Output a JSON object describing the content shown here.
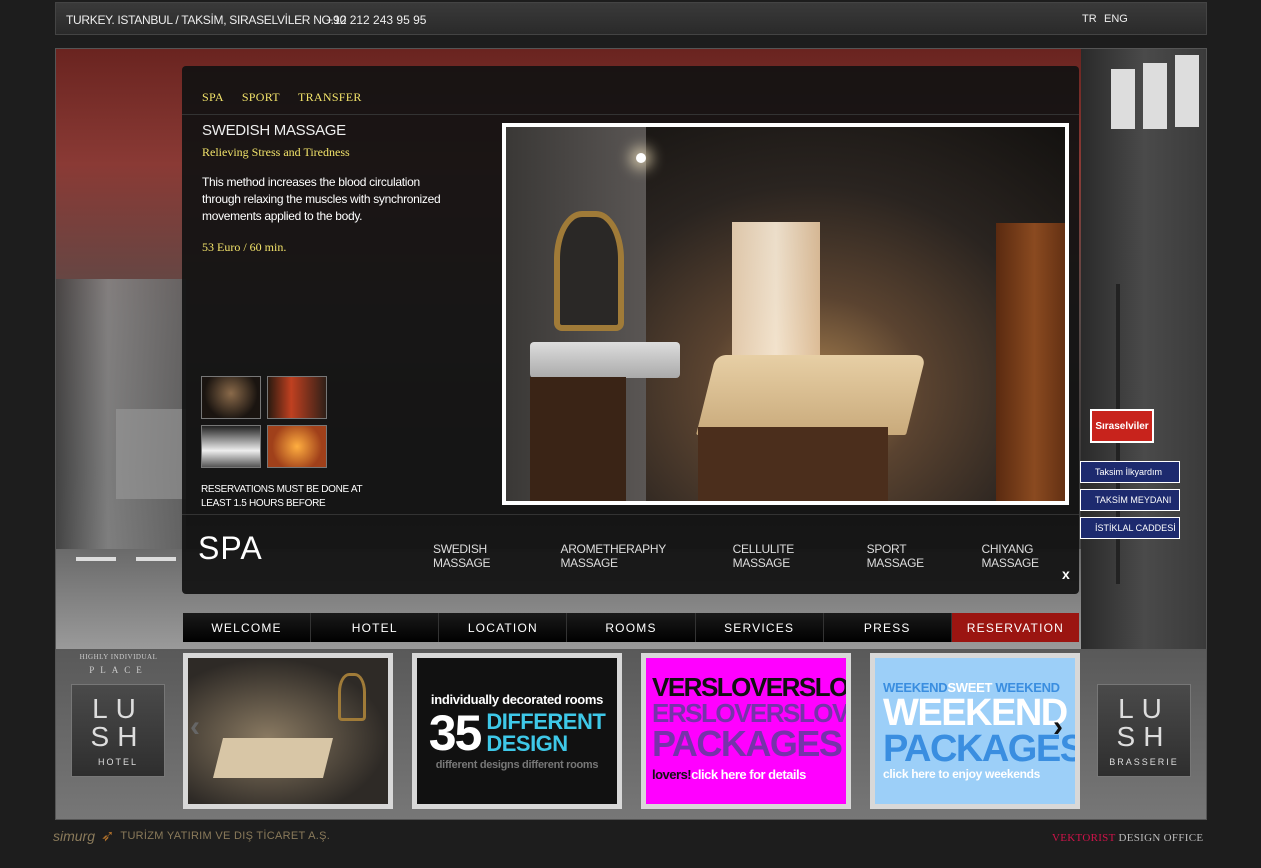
{
  "topbar": {
    "address": "TURKEY. ISTANBUL / TAKSİM, SIRASELVİLER NO.12",
    "phone": "+90 212 243 95 95",
    "languages": [
      "TR",
      "ENG"
    ]
  },
  "panel": {
    "subnav": [
      "SPA",
      "SPORT",
      "TRANSFER"
    ],
    "treatment": {
      "title": "SWEDISH MASSAGE",
      "subtitle": "Relieving Stress and Tiredness",
      "description": "This method increases the blood circulation through relaxing the muscles with synchronized movements applied to the body.",
      "price": "53 Euro / 60 min."
    },
    "reservation_note": "RESERVATIONS MUST BE DONE AT LEAST 1.5 HOURS BEFORE",
    "section_title": "SPA",
    "massages": [
      "SWEDISH MASSAGE",
      "AROMETHERAPHY MASSAGE",
      "CELLULITE MASSAGE",
      "SPORT MASSAGE",
      "CHIYANG MASSAGE"
    ],
    "close_label": "x"
  },
  "street": {
    "red_sign": "Sıraselviler",
    "signs": [
      "Taksim İlkyardım",
      "TAKSİM MEYDANI",
      "İSTİKLAL CADDESİ"
    ]
  },
  "mainnav": [
    "WELCOME",
    "HOTEL",
    "LOCATION",
    "ROOMS",
    "SERVICES",
    "PRESS",
    "RESERVATION"
  ],
  "branding": {
    "tagline_1": "HIGHLY INDIVIDUAL",
    "tagline_2": "PLACE",
    "hotel_logo": "LU SH",
    "hotel_caption": "HOTEL",
    "brasserie_logo": "LU SH",
    "brasserie_caption": "BRASSERIE"
  },
  "promos": {
    "rooms": {
      "line1": "individually decorated rooms",
      "number": "35",
      "word1": "DIFFERENT",
      "word2": "DESIGN",
      "line3": "different designs different rooms"
    },
    "lovers": {
      "row1": "VERSLOVERSLO",
      "row2": "ERSLOVERSLOV",
      "row3": "PACKAGES",
      "row4a": "lovers!",
      "row4b": "click here for details"
    },
    "weekend": {
      "top1": "WEEKEND",
      "top2": "SWEET",
      "top3": "WEEKEND",
      "big1": "WEEKEND",
      "big2": "PACKAGES",
      "bottom": "click here to enjoy weekends"
    }
  },
  "footer": {
    "brand": "simurg",
    "company": "TURİZM YATIRIM VE DIŞ TİCARET A.Ş.",
    "credit_a": "VEKTORIST",
    "credit_b": "DESIGN OFFICE"
  },
  "icons": {
    "prev": "chevron-left-icon",
    "next": "chevron-right-icon"
  },
  "colors": {
    "accent_yellow": "#f2e36a",
    "reservation_red": "#9b1511",
    "promo_magenta": "#ff00ff",
    "promo_blue": "#9ccff8",
    "design_cyan": "#3ec8e8"
  }
}
